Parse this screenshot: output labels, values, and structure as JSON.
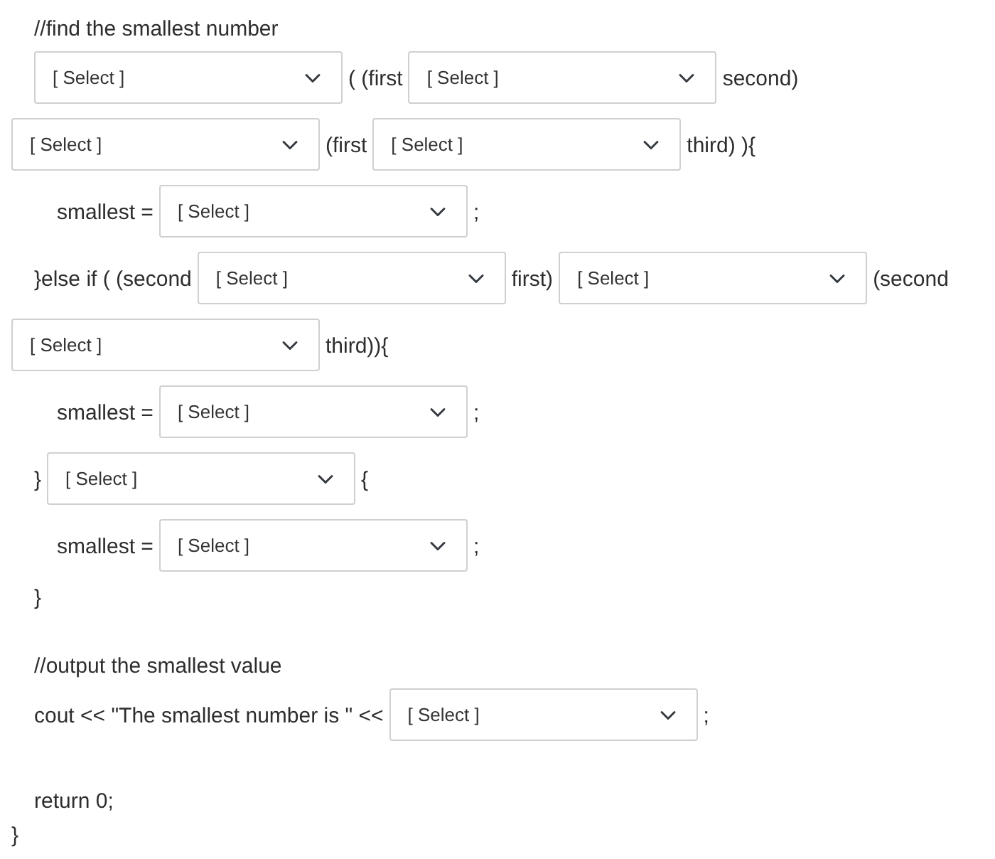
{
  "blocks": [
    {
      "lines": [
        {
          "kind": "inner",
          "parts": [
            {
              "kind": "text",
              "text": "//find the smallest number"
            }
          ]
        },
        {
          "kind": "inner",
          "parts": [
            {
              "kind": "select",
              "value": "[ Select ]"
            },
            {
              "kind": "text",
              "text": "( (first"
            },
            {
              "kind": "select",
              "value": "[ Select ]"
            },
            {
              "kind": "text",
              "text": "second)"
            }
          ]
        },
        {
          "kind": "outer",
          "parts": [
            {
              "kind": "select",
              "value": "[ Select ]"
            },
            {
              "kind": "text",
              "text": "(first"
            },
            {
              "kind": "select",
              "value": "[ Select ]"
            },
            {
              "kind": "text",
              "text": "third) ){"
            }
          ]
        },
        {
          "kind": "nested",
          "parts": [
            {
              "kind": "text",
              "text": "smallest ="
            },
            {
              "kind": "select",
              "value": "[ Select ]"
            },
            {
              "kind": "text",
              "text": ";"
            }
          ]
        },
        {
          "kind": "inner",
          "parts": [
            {
              "kind": "text",
              "text": "}else if ( (second"
            },
            {
              "kind": "select",
              "value": "[ Select ]"
            },
            {
              "kind": "text",
              "text": "first)"
            },
            {
              "kind": "select",
              "value": "[ Select ]"
            },
            {
              "kind": "text",
              "text": "(second"
            }
          ]
        },
        {
          "kind": "outer",
          "parts": [
            {
              "kind": "select",
              "value": "[ Select ]"
            },
            {
              "kind": "text",
              "text": "third)){"
            }
          ]
        },
        {
          "kind": "nested",
          "parts": [
            {
              "kind": "text",
              "text": "smallest ="
            },
            {
              "kind": "select",
              "value": "[ Select ]"
            },
            {
              "kind": "text",
              "text": ";"
            }
          ]
        },
        {
          "kind": "inner",
          "parts": [
            {
              "kind": "text",
              "text": "}"
            },
            {
              "kind": "select",
              "value": "[ Select ]"
            },
            {
              "kind": "text",
              "text": "{"
            }
          ]
        },
        {
          "kind": "nested",
          "parts": [
            {
              "kind": "text",
              "text": "smallest ="
            },
            {
              "kind": "select",
              "value": "[ Select ]"
            },
            {
              "kind": "text",
              "text": ";"
            }
          ]
        },
        {
          "kind": "inner",
          "parts": [
            {
              "kind": "text",
              "text": "}"
            }
          ]
        }
      ]
    },
    {
      "lines": [
        {
          "kind": "inner",
          "parts": [
            {
              "kind": "text",
              "text": "//output the smallest value"
            }
          ]
        },
        {
          "kind": "inner",
          "parts": [
            {
              "kind": "text",
              "text": "cout << \"The smallest number is \" <<"
            },
            {
              "kind": "select",
              "value": "[ Select ]"
            },
            {
              "kind": "text",
              "text": ";"
            }
          ]
        }
      ]
    },
    {
      "lines": [
        {
          "kind": "inner",
          "parts": [
            {
              "kind": "text",
              "text": "return 0;"
            }
          ]
        },
        {
          "kind": "outer",
          "parts": [
            {
              "kind": "text",
              "text": "}"
            }
          ]
        }
      ]
    }
  ]
}
